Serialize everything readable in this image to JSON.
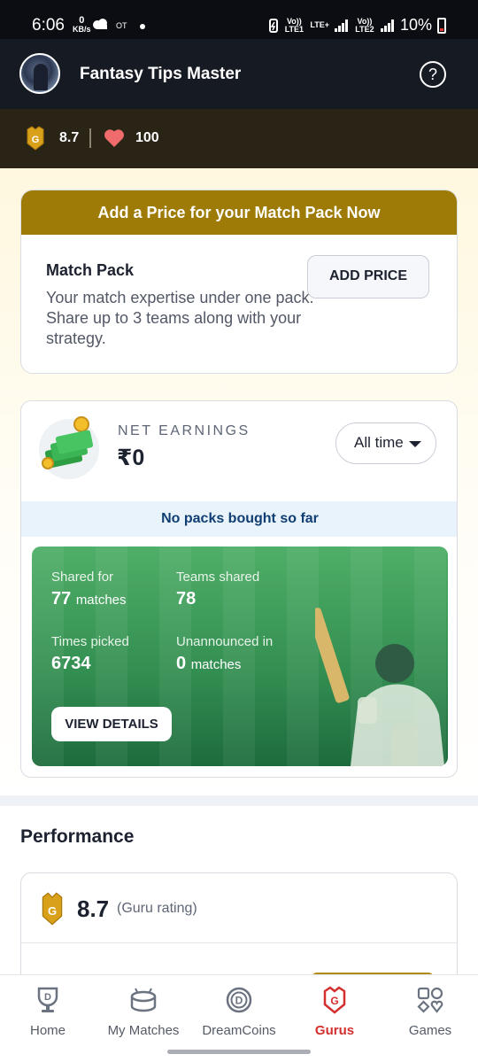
{
  "status_bar": {
    "time": "6:06",
    "net_speed_value": "0",
    "net_speed_unit": "KB/s",
    "ot_label": "OT",
    "sim1_label": "Vo)) LTE1",
    "lte_label": "LTE+",
    "sim2_label": "Vo)) LTE2",
    "battery": "10%"
  },
  "header": {
    "title": "Fantasy Tips Master"
  },
  "stats": {
    "rating": "8.7",
    "likes": "100",
    "badge_letter": "G"
  },
  "price_card": {
    "banner": "Add a Price for your Match Pack Now",
    "title": "Match Pack",
    "description": "Your match expertise under one pack. Share up to 3 teams along with your strategy.",
    "button": "ADD PRICE"
  },
  "earnings_card": {
    "label": "NET EARNINGS",
    "value": "₹0",
    "filter": "All time",
    "notice": "No packs bought so far",
    "shared_for_label": "Shared for",
    "shared_for_value": "77",
    "shared_for_unit": "matches",
    "teams_shared_label": "Teams shared",
    "teams_shared_value": "78",
    "times_picked_label": "Times picked",
    "times_picked_value": "6734",
    "unannounced_label": "Unannounced in",
    "unannounced_value": "0",
    "unannounced_unit": "matches",
    "button": "VIEW DETAILS"
  },
  "performance": {
    "title": "Performance",
    "rating_value": "8.7",
    "rating_label": "(Guru rating)"
  },
  "nav": {
    "items": [
      {
        "label": "Home",
        "icon": "trophy-d-icon"
      },
      {
        "label": "My Matches",
        "icon": "stadium-icon"
      },
      {
        "label": "DreamCoins",
        "icon": "coin-d-icon"
      },
      {
        "label": "Gurus",
        "icon": "guru-badge-icon"
      },
      {
        "label": "Games",
        "icon": "games-icon"
      }
    ],
    "active": "Gurus"
  },
  "colors": {
    "header_bg": "#161a22",
    "gold": "#9e7b06",
    "accent_red": "#d32f2f",
    "green": "#349052",
    "notice_text": "#103e73"
  }
}
